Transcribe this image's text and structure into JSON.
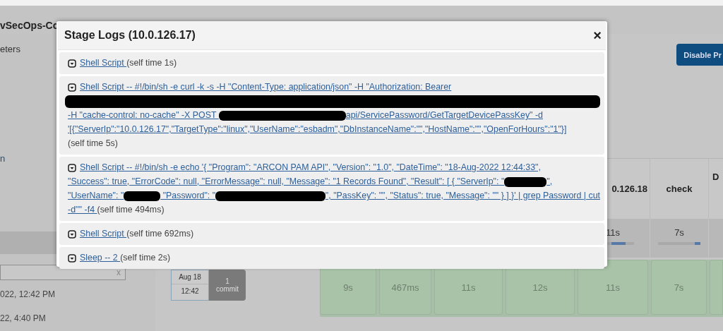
{
  "page": {
    "title": "vSecOps-Cc",
    "sidebar_texts": [
      "eters",
      "n"
    ],
    "search_clear": "x",
    "dates": [
      "022, 12:42 PM",
      "22, 4:40 PM"
    ],
    "disable_button": "Disable Pr",
    "stage_columns": [
      {
        "header": "0.126.18",
        "average": "11s"
      },
      {
        "header": "check",
        "average": "7s"
      },
      {
        "header": "D"
      }
    ],
    "build": {
      "date": "Aug 18",
      "time": "12:42",
      "commit_count": "1",
      "commit_label": "commit",
      "cells": [
        "9s",
        "467ms",
        "11s",
        "12s",
        "11s",
        "7s"
      ]
    }
  },
  "modal": {
    "title": "Stage Logs (10.0.126.17)",
    "close": "×",
    "entries": [
      {
        "lines": [
          [
            {
              "kind": "link",
              "text": "Shell Script "
            },
            {
              "kind": "text",
              "text": "(self time 1s)"
            }
          ]
        ]
      },
      {
        "lines": [
          [
            {
              "kind": "link",
              "text": "Shell Script -- #!/bin/sh -e curl -k -s -H \"Content-Type: application/json\" -H \"Authorization: Bearer"
            }
          ],
          [
            {
              "kind": "redaction-line"
            }
          ],
          [
            {
              "kind": "link",
              "text": "-H \"cache-control: no-cache\" -X POST "
            },
            {
              "kind": "redaction",
              "wide": true
            },
            {
              "kind": "link",
              "text": "api/ServicePassword/GetTargetDevicePassKey\" -d"
            }
          ],
          [
            {
              "kind": "link",
              "text": "'[{\"ServerIp\":\"10.0.126.17\",\"TargetType\":\"linux\",\"UserName\":\"esbadm\",\"DbInstanceName\":\"\",\"HostName\":\"\",\"OpenForHours\":\"1\"}]"
            }
          ],
          [
            {
              "kind": "text",
              "text": "(self time 5s)"
            }
          ]
        ]
      },
      {
        "lines": [
          [
            {
              "kind": "link",
              "text": "Shell Script -- #!/bin/sh -e echo '{ \"Program\": \"ARCON PAM API\", \"Version\": \"1.0\", \"DateTime\": \"18-Aug-2022 12:44:33\","
            }
          ],
          [
            {
              "kind": "link",
              "text": "\"Success\": true, \"ErrorCode\": null, \"ErrorMessage\": null, \"Message\": \"1 Records Found\", \"Result\": [ { \"ServerIp\": \""
            },
            {
              "kind": "redaction",
              "wide": false
            },
            {
              "kind": "link",
              "text": "\","
            }
          ],
          [
            {
              "kind": "link",
              "text": "\"UserName\": \""
            },
            {
              "kind": "redaction",
              "wide": false
            },
            {
              "kind": "link",
              "text": " \"Password\": \""
            },
            {
              "kind": "redaction",
              "wide": true
            },
            {
              "kind": "link",
              "text": "\", \"PassKey\": \"\", \"Status\": true, \"Message\": \"\" } ] }' | grep Password | cut"
            }
          ],
          [
            {
              "kind": "link",
              "text": "-d'\"' -f4 "
            },
            {
              "kind": "text",
              "text": "(self time 494ms)"
            }
          ]
        ]
      },
      {
        "lines": [
          [
            {
              "kind": "link",
              "text": "Shell Script "
            },
            {
              "kind": "text",
              "text": "(self time 692ms)"
            }
          ]
        ]
      },
      {
        "lines": [
          [
            {
              "kind": "link",
              "text": "Sleep -- 2 "
            },
            {
              "kind": "text",
              "text": "(self time 2s)"
            }
          ]
        ]
      }
    ]
  }
}
